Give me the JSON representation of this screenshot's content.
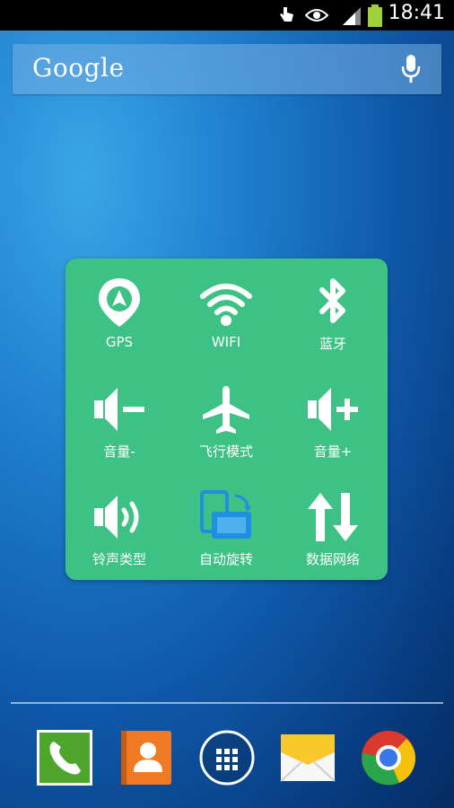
{
  "status_bar": {
    "time": "18:41",
    "icons": [
      "hand-touch-icon",
      "eye-icon",
      "signal-icon",
      "battery-icon"
    ]
  },
  "search_bar": {
    "logo_text": "Google",
    "icon": "mic-icon"
  },
  "quick_settings": {
    "background_color": "#3ec184",
    "tiles": [
      {
        "label": "GPS",
        "icon": "gps-icon"
      },
      {
        "label": "WIFI",
        "icon": "wifi-icon"
      },
      {
        "label": "蓝牙",
        "icon": "bluetooth-icon"
      },
      {
        "label": "音量-",
        "icon": "volume-down-icon"
      },
      {
        "label": "飞行模式",
        "icon": "airplane-icon"
      },
      {
        "label": "音量+",
        "icon": "volume-up-icon"
      },
      {
        "label": "铃声类型",
        "icon": "ringtone-icon"
      },
      {
        "label": "自动旋转",
        "icon": "auto-rotate-icon"
      },
      {
        "label": "数据网络",
        "icon": "data-network-icon"
      }
    ]
  },
  "dock": {
    "apps": [
      {
        "icon": "phone-icon"
      },
      {
        "icon": "contacts-icon"
      },
      {
        "icon": "app-drawer-icon"
      },
      {
        "icon": "email-icon"
      },
      {
        "icon": "chrome-icon"
      }
    ]
  }
}
